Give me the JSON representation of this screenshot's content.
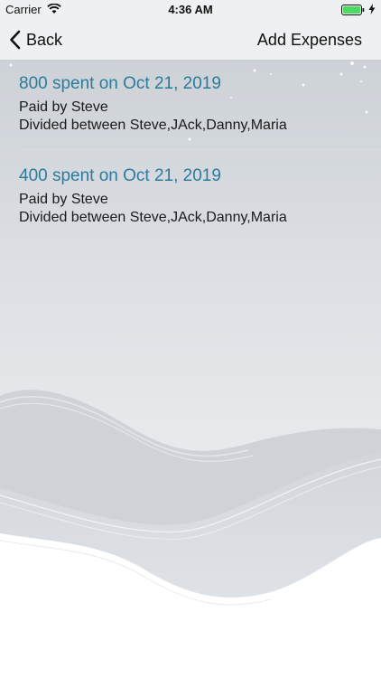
{
  "status_bar": {
    "carrier": "Carrier",
    "time": "4:36 AM",
    "battery_color": "#4cd964"
  },
  "nav": {
    "back_label": "Back",
    "action_label": "Add Expenses"
  },
  "expenses": [
    {
      "title": "800 spent on Oct 21, 2019",
      "paid_by": "Paid by Steve",
      "divided": "Divided between Steve,JAck,Danny,Maria"
    },
    {
      "title": "400 spent on Oct 21, 2019",
      "paid_by": "Paid by Steve",
      "divided": "Divided between Steve,JAck,Danny,Maria"
    }
  ],
  "colors": {
    "accent": "#2b7b9c",
    "nav_background": "#eef0f2"
  }
}
